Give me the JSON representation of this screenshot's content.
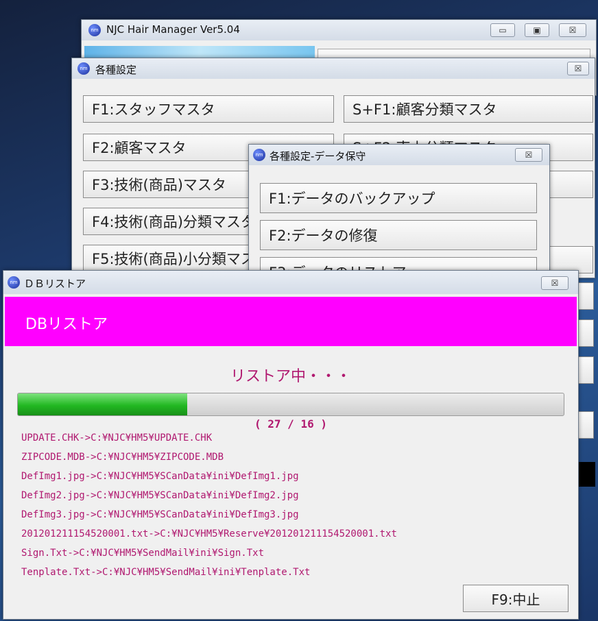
{
  "main_window": {
    "title": "NJC Hair Manager Ver5.04"
  },
  "settings_window": {
    "title": "各種設定",
    "buttons": [
      "F1:スタッフマスタ",
      "S+F1:顧客分類マスタ",
      "F2:顧客マスタ",
      "S+F2:売上分類マスタ",
      "F3:技術(商品)マスタ",
      "F4:技術(商品)分類マスタ",
      "F5:技術(商品)小分類マスタ"
    ]
  },
  "maintenance_window": {
    "title": "各種設定-データ保守",
    "buttons": [
      "F1:データのバックアップ",
      "F2:データの修復",
      "F3:データのリストア"
    ]
  },
  "restore_window": {
    "title": "ＤＢリストア",
    "header": "DBリストア",
    "status": "リストア中・・・",
    "progress_label": "( 27 / 16 )",
    "progress_fraction": 0.31,
    "log_lines": [
      "UPDATE.CHK->C:¥NJC¥HM5¥UPDATE.CHK",
      "ZIPCODE.MDB->C:¥NJC¥HM5¥ZIPCODE.MDB",
      "DefImg1.jpg->C:¥NJC¥HM5¥SCanData¥ini¥DefImg1.jpg",
      "DefImg2.jpg->C:¥NJC¥HM5¥SCanData¥ini¥DefImg2.jpg",
      "DefImg3.jpg->C:¥NJC¥HM5¥SCanData¥ini¥DefImg3.jpg",
      "201201211154520001.txt->C:¥NJC¥HM5¥Reserve¥201201211154520001.txt",
      "Sign.Txt->C:¥NJC¥HM5¥SendMail¥ini¥Sign.Txt",
      "Tenplate.Txt->C:¥NJC¥HM5¥SendMail¥ini¥Tenplate.Txt"
    ],
    "cancel_label": "F9:中止"
  },
  "colors": {
    "header_magenta": "#ff00ff",
    "text_magenta": "#b0186f",
    "progress_green": "#22b822"
  }
}
